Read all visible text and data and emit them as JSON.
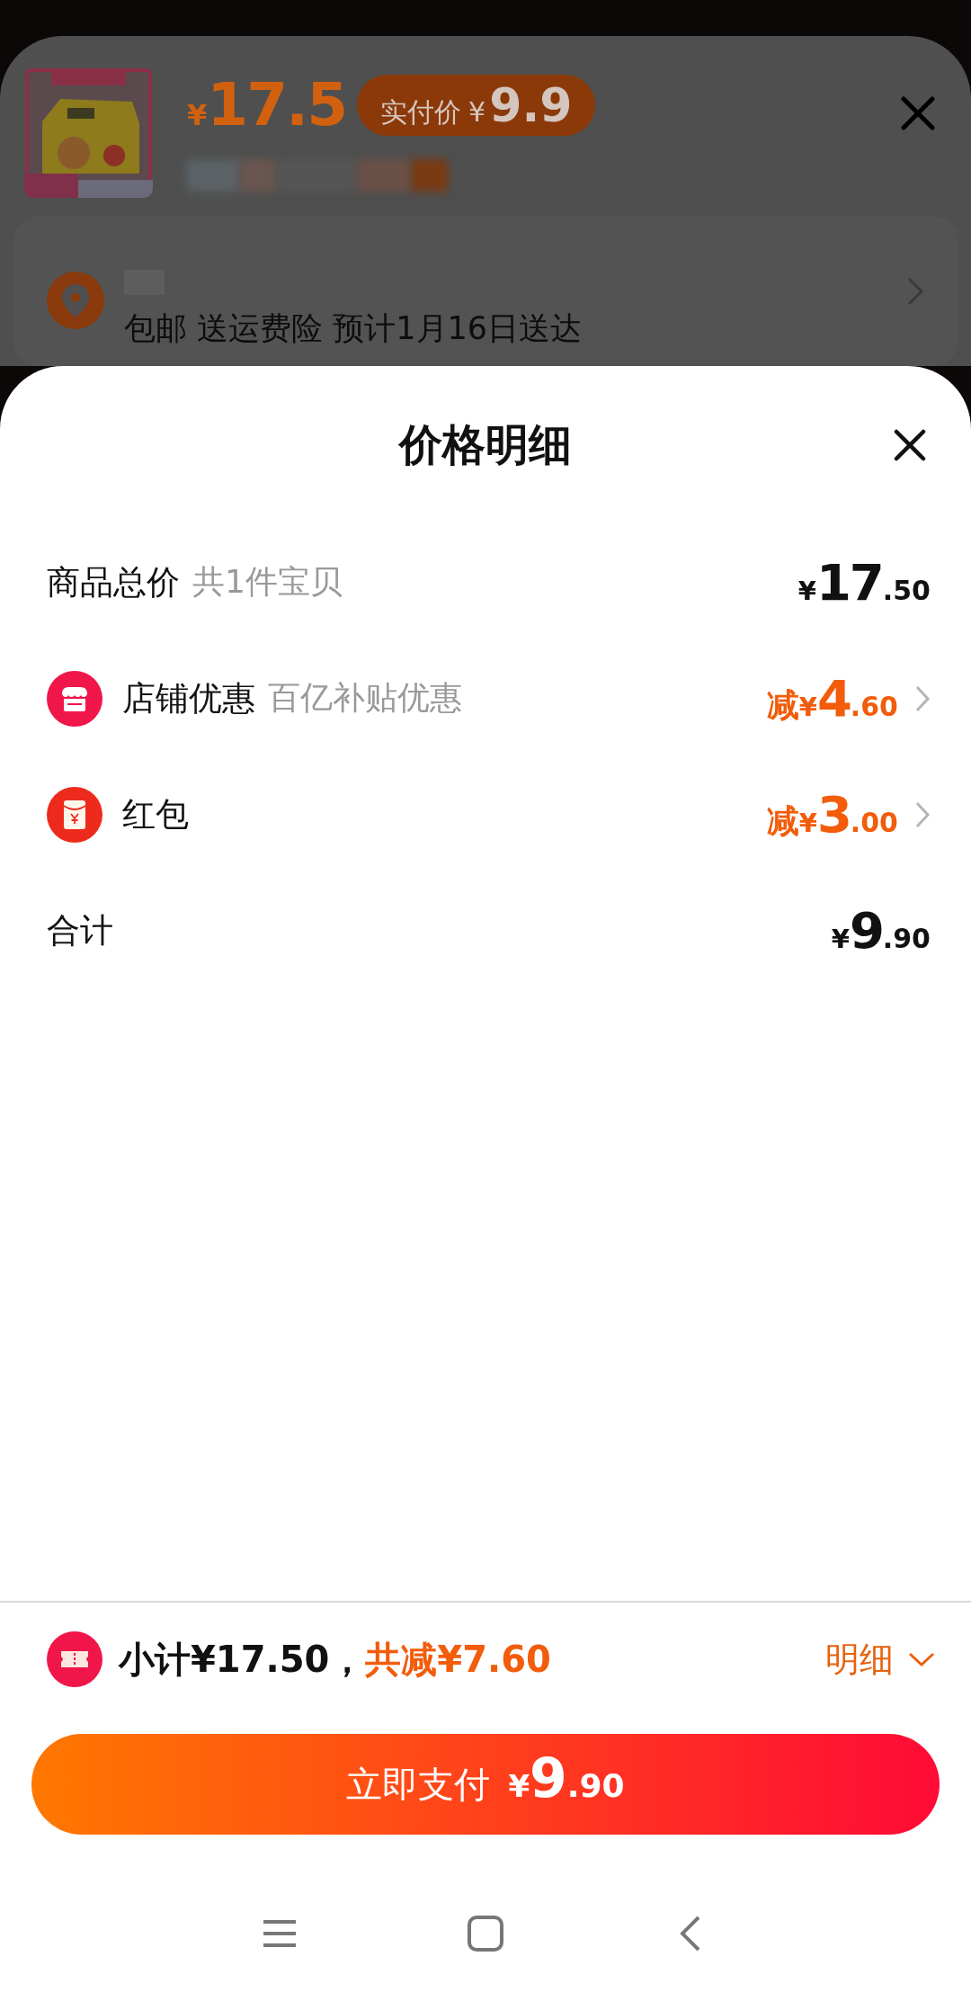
{
  "background": {
    "product": {
      "price_symbol": "¥",
      "price": "17.5",
      "badge_label": "实付价",
      "badge_symbol": "¥",
      "badge_price": "9.9"
    },
    "address": {
      "delivery": "包邮 送运费险 预计1月16日送达"
    }
  },
  "sheet": {
    "title": "价格明细",
    "rows": [
      {
        "kind": "total",
        "label": "商品总价",
        "note": "共1件宝贝",
        "prefix": "",
        "symbol": "¥",
        "integer": "17",
        "fraction": ".50"
      },
      {
        "kind": "store-discount",
        "label": "店铺优惠",
        "note": "百亿补贴优惠",
        "prefix": "减",
        "symbol": "¥",
        "integer": "4",
        "fraction": ".60"
      },
      {
        "kind": "red-packet",
        "label": "红包",
        "note": "",
        "prefix": "减",
        "symbol": "¥",
        "integer": "3",
        "fraction": ".00"
      },
      {
        "kind": "sum",
        "label": "合计",
        "note": "",
        "prefix": "",
        "symbol": "¥",
        "integer": "9",
        "fraction": ".90"
      }
    ],
    "summary": {
      "subtotal": "小计¥17.50，",
      "reduction": "共减¥7.60",
      "detail_link": "明细",
      "expanded": true
    },
    "pay_button": {
      "label": "立即支付",
      "symbol": "¥",
      "integer": "9",
      "fraction": ".90"
    }
  }
}
